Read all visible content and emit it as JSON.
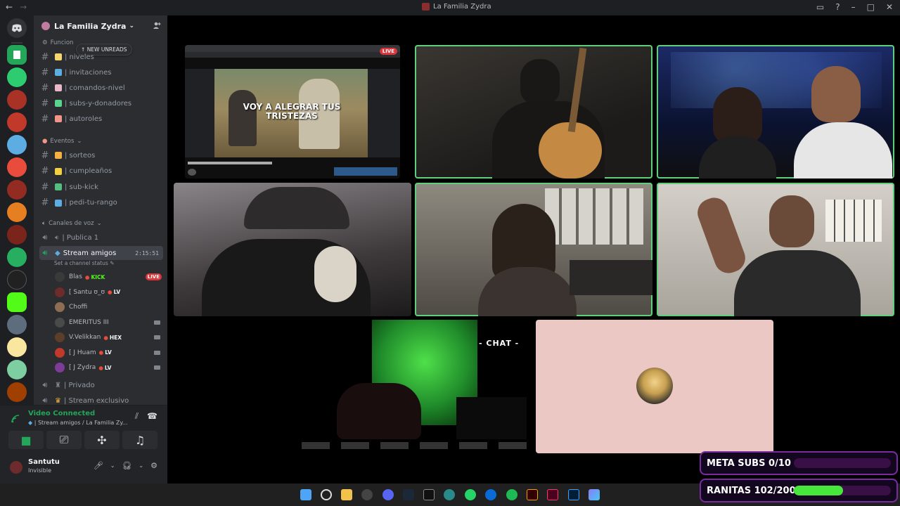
{
  "window": {
    "title": "La Familia Zydra"
  },
  "server": {
    "name": "La Familia Zydra",
    "new_unreads": "NEW UNREADS"
  },
  "categories": {
    "funciones": "Funcion",
    "eventos": "Eventos",
    "voz": "Canales de voz"
  },
  "text_channels": [
    {
      "name": "| niveles",
      "color": "#f5d76e"
    },
    {
      "name": "| invitaciones",
      "color": "#5dade2"
    },
    {
      "name": "| comandos-nivel",
      "color": "#e8b7c8"
    },
    {
      "name": "| subs-y-donadores",
      "color": "#58d68d"
    },
    {
      "name": "| autoroles",
      "color": "#f1948a"
    }
  ],
  "event_channels": [
    {
      "name": "| sorteos",
      "color": "#f5b041"
    },
    {
      "name": "| cumpleaños",
      "color": "#f4d03f"
    },
    {
      "name": "| sub-kick",
      "color": "#52be80"
    },
    {
      "name": "| pedi-tu-rango",
      "color": "#5dade2"
    }
  ],
  "voice_channels": [
    {
      "name": "| Publica 1"
    },
    {
      "name": "Stream amigos",
      "duration": "2:15:51",
      "status": "Set a channel status"
    },
    {
      "name": "| Privado"
    },
    {
      "name": "| Stream exclusivo"
    }
  ],
  "members": [
    {
      "name": "Blas",
      "tag": "KICK",
      "tag_color": "#53fc18",
      "live": "LIVE",
      "color": "#3a3a3a"
    },
    {
      "name": "[ Santu ʊ_ʊ",
      "tag": "LV",
      "tag_color": "#f2f3f5",
      "color": "#6d2b2b"
    },
    {
      "name": "Choffi",
      "tag": "",
      "color": "#8e6e53"
    },
    {
      "name": "EMERITUS III",
      "tag": "",
      "color": "#4a4a4a"
    },
    {
      "name": "V.Velikkan",
      "tag": "HEX",
      "tag_color": "#f2f3f5",
      "color": "#5b3f2a"
    },
    {
      "name": "[ J Huam",
      "tag": "LV",
      "tag_color": "#f2f3f5",
      "color": "#c0392b"
    },
    {
      "name": "[ J Zydra",
      "tag": "LV",
      "tag_color": "#f2f3f5",
      "color": "#7d3c98"
    }
  ],
  "voice_panel": {
    "title": "Video Connected",
    "subtitle": "| Stream amigos / La Familia Zy..."
  },
  "user": {
    "name": "Santutu",
    "status": "Invisible"
  },
  "stage": {
    "live_label": "LIVE",
    "video_overlay": "VOY A ALEGRAR TUS TRISTEZAS",
    "chat_label": "- CHAT -"
  },
  "goals": [
    {
      "label": "META SUBS 0/10",
      "progress": 0.0
    },
    {
      "label": "RANITAS 102/200",
      "progress": 0.51
    }
  ]
}
